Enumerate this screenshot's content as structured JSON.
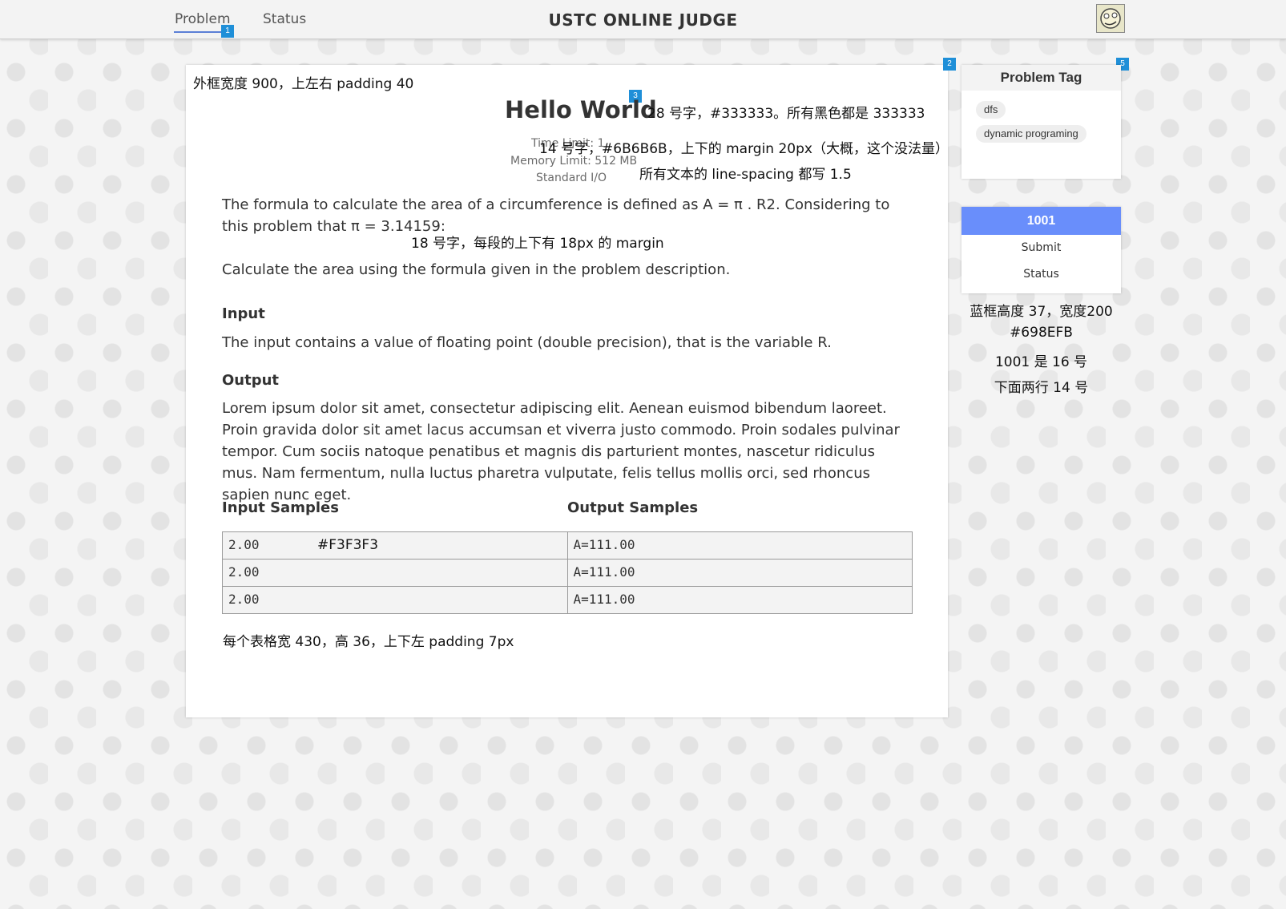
{
  "header": {
    "nav": [
      "Problem",
      "Status"
    ],
    "title": "USTC ONLINE JUDGE",
    "active_tab": "Problem"
  },
  "markers": [
    "1",
    "2",
    "3",
    "5"
  ],
  "problem": {
    "title": "Hello World",
    "time_limit": "Time Limit: 1",
    "memory_limit": "Memory Limit: 512 MB",
    "io": "Standard I/O",
    "description_1": "The formula to calculate the area of a circumference is defined as A = π . R2. Considering to this problem that π = 3.14159:",
    "description_2": "Calculate the area using the formula given in the problem description.",
    "input_heading": "Input",
    "input_text": "The input contains a value of floating point (double precision), that is the variable R.",
    "output_heading": "Output",
    "output_text": "Lorem ipsum dolor sit amet, consectetur adipiscing elit. Aenean euismod bibendum laoreet. Proin gravida dolor sit amet lacus accumsan et viverra justo commodo. Proin sodales pulvinar tempor. Cum sociis natoque penatibus et magnis dis parturient montes, nascetur ridiculus mus. Nam fermentum, nulla luctus pharetra vulputate, felis tellus mollis orci, sed rhoncus sapien nunc eget.",
    "input_samples_heading": "Input Samples",
    "output_samples_heading": "Output Samples",
    "samples": [
      {
        "input": "2.00",
        "output": "A=111.00"
      },
      {
        "input": "2.00",
        "output": "A=111.00"
      },
      {
        "input": "2.00",
        "output": "A=111.00"
      }
    ]
  },
  "notes": {
    "outer_box": "外框宽度 900，上左右 padding 40",
    "title_font": "28 号字，#333333。所有黑色都是 333333",
    "meta_font": "14 号字，#6B6B6B，上下的 margin 20px（大概，这个没法量）",
    "line_spacing": "所有文本的 line-spacing 都写 1.5",
    "para_font": "18 号字，每段的上下有 18px 的 margin",
    "table_color": "#F3F3F3",
    "table_cell": "每个表格宽 430，高 36，上下左 padding 7px",
    "side_1": "蓝框高度 37，宽度200",
    "side_2": "#698EFB",
    "side_3": "1001 是 16 号",
    "side_4": "下面两行 14 号"
  },
  "sidebar": {
    "tag_title": "Problem Tag",
    "tags": [
      "dfs",
      "dynamic programing"
    ],
    "problem_id": "1001",
    "submit_label": "Submit",
    "status_label": "Status"
  },
  "colors": {
    "primary_blue": "#698EFB",
    "marker_blue": "#1f8fd8",
    "text": "#333333",
    "meta_text": "#6B6B6B",
    "table_bg": "#F3F3F3"
  }
}
